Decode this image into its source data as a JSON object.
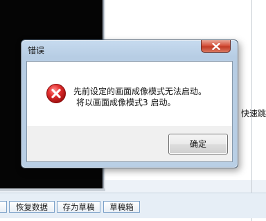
{
  "dialog": {
    "title": "错误",
    "message_line1": "先前设定的画面成像模式无法启动。",
    "message_line2": "将以画面成像模式3 启动。",
    "ok_label": "确定",
    "icon": "error-icon"
  },
  "background": {
    "side_label": "快速跳",
    "buttons": [
      "恢复数据",
      "存为草稿",
      "草稿箱"
    ]
  }
}
